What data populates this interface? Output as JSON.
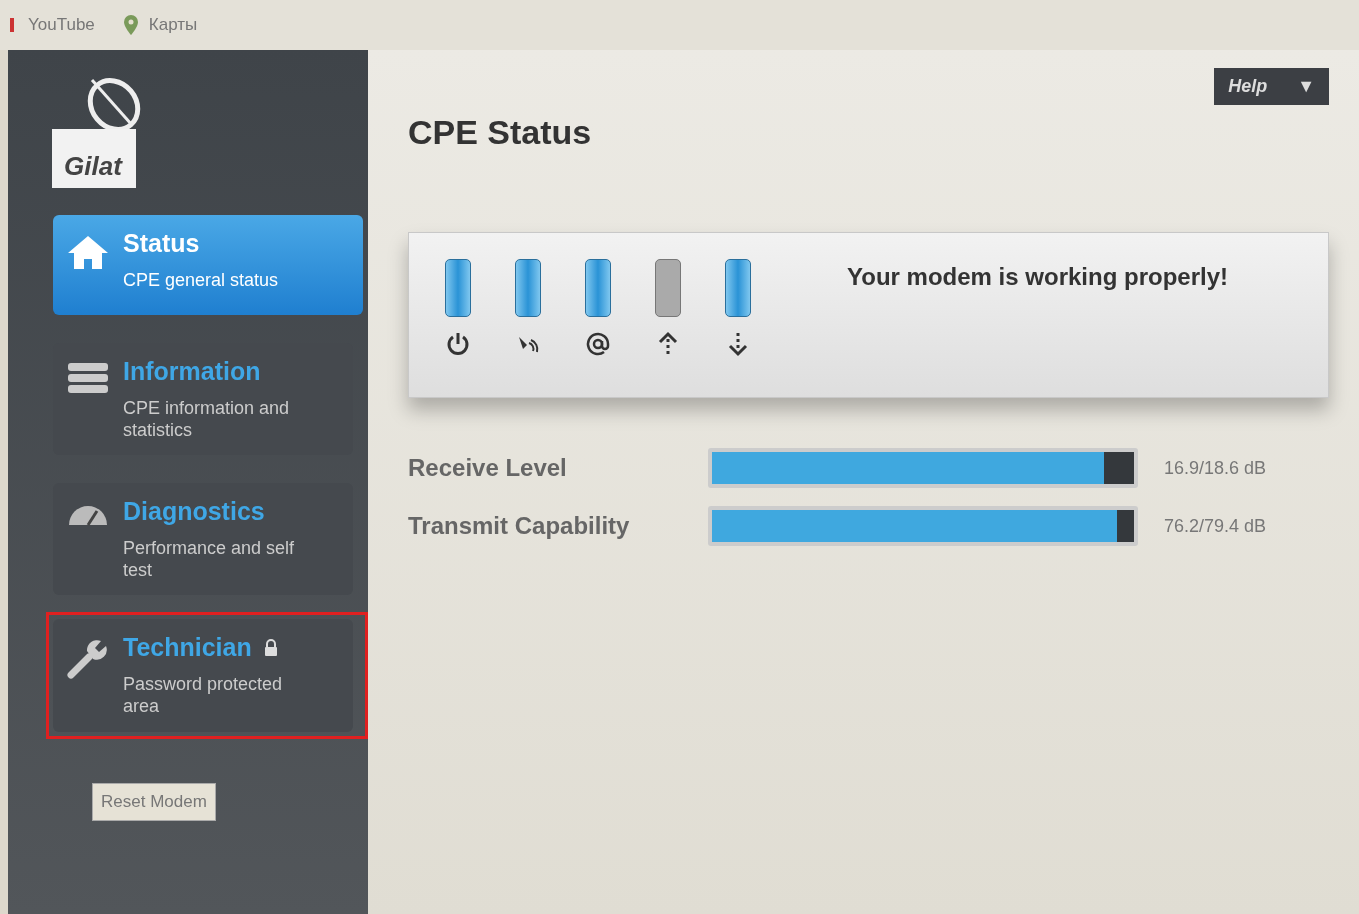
{
  "bookmarks": [
    {
      "label": "YouTube",
      "kind": "youtube"
    },
    {
      "label": "Карты",
      "kind": "maps"
    }
  ],
  "sidebar": {
    "logo": "Gilat",
    "items": [
      {
        "title": "Status",
        "subtitle": "CPE general status",
        "kind": "home",
        "selected": true,
        "locked": false,
        "highlighted": false
      },
      {
        "title": "Information",
        "subtitle": "CPE information and statistics",
        "kind": "list",
        "selected": false,
        "locked": false,
        "highlighted": false
      },
      {
        "title": "Diagnostics",
        "subtitle": "Performance and self test",
        "kind": "gauge",
        "selected": false,
        "locked": false,
        "highlighted": false
      },
      {
        "title": "Technician",
        "subtitle": "Password protected area",
        "kind": "wrench",
        "selected": false,
        "locked": true,
        "highlighted": true
      }
    ],
    "reset_button": "Reset Modem"
  },
  "help": {
    "label": "Help",
    "caret": "▼"
  },
  "title": "CPE Status",
  "leds": [
    {
      "kind": "power",
      "on": true
    },
    {
      "kind": "satellite",
      "on": true
    },
    {
      "kind": "at",
      "on": true
    },
    {
      "kind": "up",
      "on": false
    },
    {
      "kind": "down",
      "on": true
    }
  ],
  "message": "Your modem is working properly!",
  "meters": [
    {
      "label": "Receive Level",
      "level": 0.93,
      "reading": "16.9/18.6 dB"
    },
    {
      "label": "Transmit Capability",
      "level": 0.96,
      "reading": "76.2/79.4 dB"
    }
  ]
}
